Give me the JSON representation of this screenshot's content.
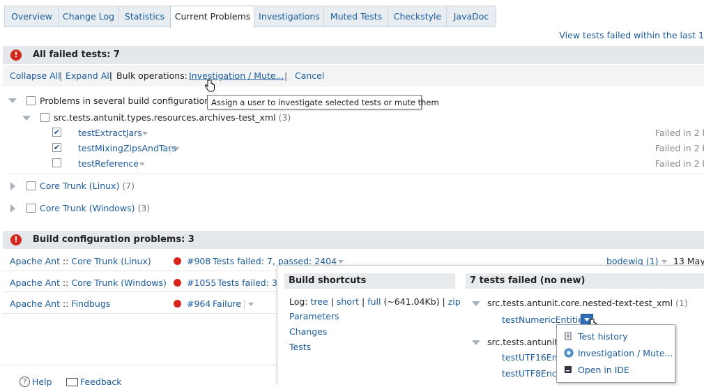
{
  "tabs": [
    "Overview",
    "Change Log",
    "Statistics",
    "Current Problems",
    "Investigations",
    "Muted Tests",
    "Checkstyle",
    "JavaDoc"
  ],
  "view_failed_link": "View tests failed within the last 1",
  "failed_section": {
    "icon": "error-icon",
    "title": "All failed tests: 7"
  },
  "bulk": {
    "collapse": "Collapse All",
    "expand": "Expand All",
    "label": "Bulk operations:",
    "investigate": "Investigation / Mute...",
    "cancel": "Cancel"
  },
  "tooltip": "Assign a user to investigate selected tests or mute them",
  "tree": {
    "group_label": "Problems in several build configurations",
    "group_count": "(",
    "suite": "src.tests.antunit.types.resources.archives-test_xml",
    "suite_count": "(3)",
    "tests": [
      {
        "name": "testExtractJars",
        "checked": true,
        "status": "Failed in 2 b"
      },
      {
        "name": "testMixingZipsAndTars",
        "checked": true,
        "status": "Failed in 2 b"
      },
      {
        "name": "testReference",
        "checked": false,
        "status": "Failed in 2 b"
      }
    ],
    "configs": [
      {
        "name": "Core Trunk (Linux)",
        "count": "(7)"
      },
      {
        "name": "Core Trunk (Windows)",
        "count": "(3)"
      }
    ]
  },
  "build_section": {
    "icon": "error-icon",
    "title": "Build configuration problems: 3"
  },
  "build_rows": [
    {
      "project": "Apache Ant",
      "sep": "::",
      "config": "Core Trunk (Linux)",
      "build": "#908",
      "status": "Tests failed: 7, passed: 2404",
      "user": "bodewig (1)",
      "date": "13 May"
    },
    {
      "project": "Apache Ant",
      "sep": "::",
      "config": "Core Trunk (Windows)",
      "build": "#1055",
      "status": "Tests failed: 3,"
    },
    {
      "project": "Apache Ant",
      "sep": "::",
      "config": "Findbugs",
      "build": "#964",
      "status": "Failure"
    }
  ],
  "popup": {
    "shortcuts_title": "Build shortcuts",
    "log_label": "Log:",
    "log_tree": "tree",
    "log_short": "short",
    "log_full": "full",
    "log_size": "(~641.04Kb)",
    "log_zip": "zip",
    "links": [
      "Parameters",
      "Changes",
      "Tests"
    ],
    "failed_title": "7 tests failed (no new)",
    "suite1": "src.tests.antunit.core.nested-text-test_xml",
    "suite1_count": "(1)",
    "test1": "testNumericEntities",
    "suite2": "src.tests.antunit.t",
    "test2": "testUTF16Enco",
    "test3": "testUTF8Enco"
  },
  "context_menu": {
    "items": [
      {
        "label": "Test history",
        "icon": "document-icon"
      },
      {
        "label": "Investigation / Mute...",
        "icon": "investigate-icon"
      },
      {
        "label": "Open in IDE",
        "icon": "ide-icon"
      }
    ]
  },
  "footer": {
    "help": "Help",
    "feedback": "Feedback"
  }
}
